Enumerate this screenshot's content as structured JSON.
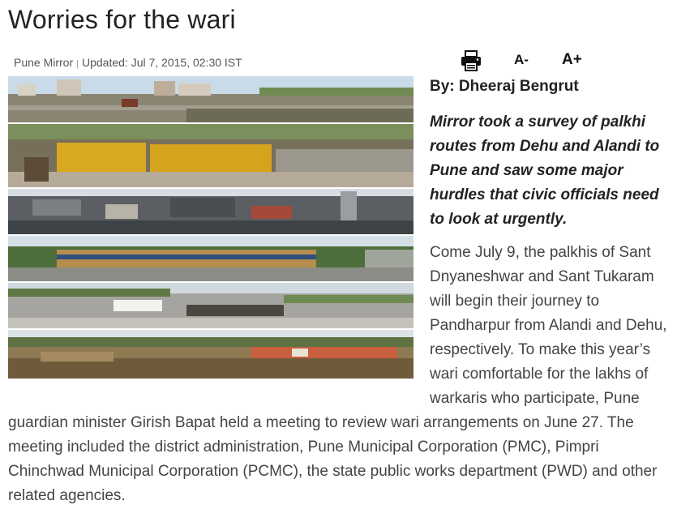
{
  "article": {
    "headline": "Worries for the wari",
    "source": "Pune Mirror",
    "separator": "|",
    "updated": "Updated: Jul 7, 2015, 02:30 IST",
    "byline": "By: Dheeraj Bengrut",
    "intro": "Mirror took a survey of palkhi routes from Dehu and Alandi to Pune and saw some major hurdles that civic officials need to look at urgently.",
    "body": "Come July 9, the palkhis of Sant Dnyaneshwar and Sant Tukaram will begin their journey to Pandharpur from Alandi and Dehu, respectively. To make this year’s wari comfortable for the lakhs of warkaris who participate, Pune guardian minister Girish Bapat held a meeting to review wari arrangements on June 27. The meeting included the district administration, Pune Municipal Corporation (PMC), Pimpri Chinchwad Municipal Corporation (PCMC), the state public works department (PWD) and other related agencies."
  },
  "toolbar": {
    "print_icon": "printer-icon",
    "decrease_label": "A-",
    "increase_label": "A+"
  }
}
